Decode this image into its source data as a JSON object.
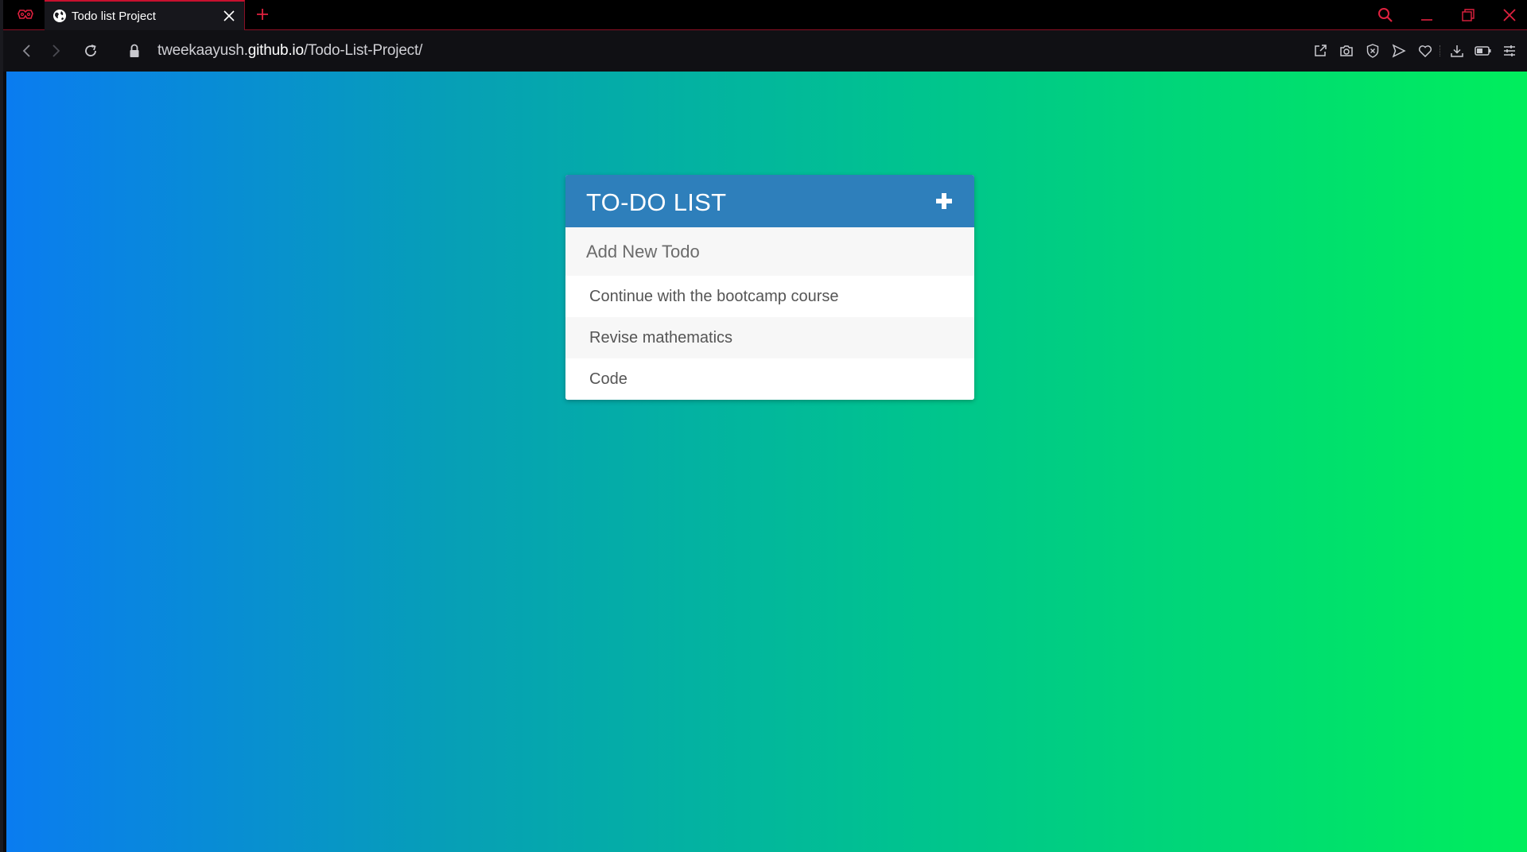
{
  "browser": {
    "tab": {
      "title": "Todo list Project",
      "favicon": "globe-icon"
    },
    "address_bar": {
      "url_prefix": "tweekaayush.",
      "url_domain": "github.io",
      "url_path": "/Todo-List-Project/"
    },
    "accent_color": "#c8102e"
  },
  "page": {
    "background_gradient": [
      "#0a7cf0",
      "#00ee5c"
    ],
    "todo": {
      "title": "TO-DO LIST",
      "input_placeholder": "Add New Todo",
      "header_color": "#2e7fbb",
      "items": [
        "Continue with the bootcamp course",
        "Revise mathematics",
        "Code"
      ]
    }
  }
}
